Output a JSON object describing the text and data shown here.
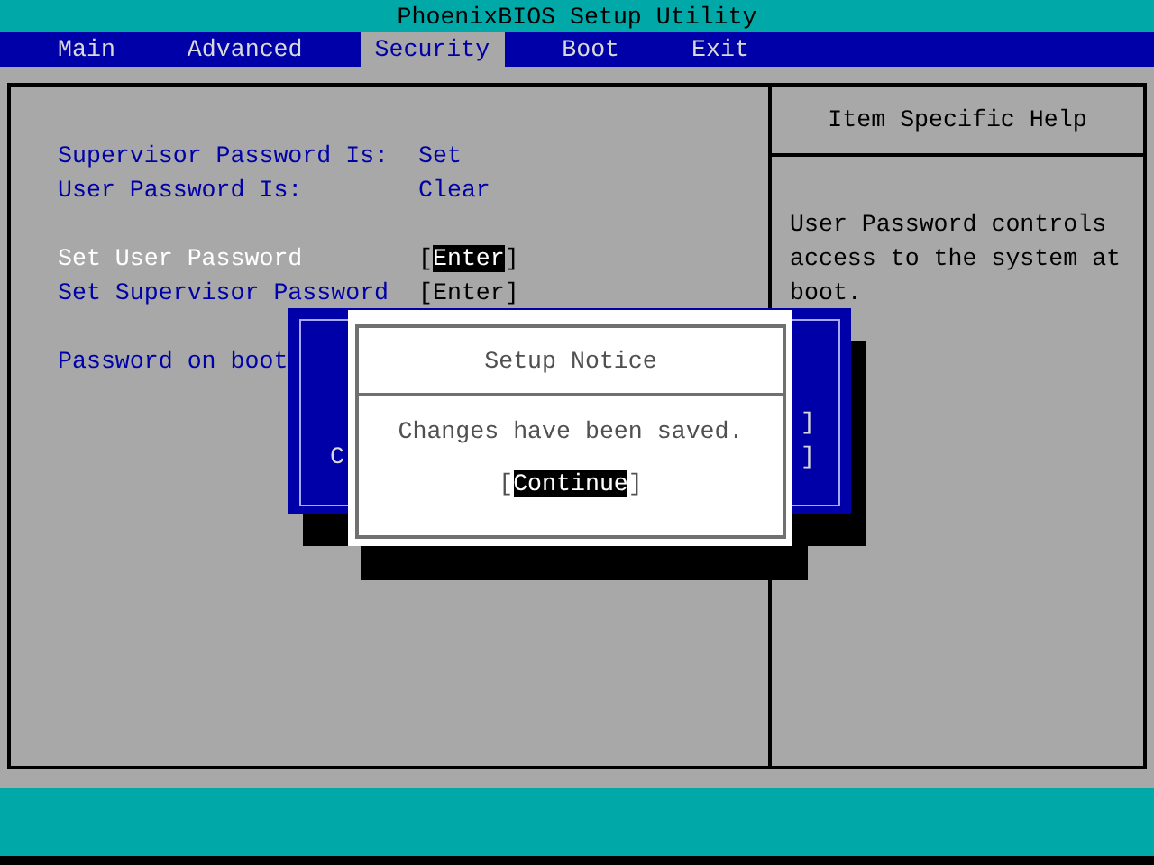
{
  "window": {
    "title": "PhoenixBIOS Setup Utility"
  },
  "tabs": [
    {
      "label": "Main",
      "selected": false
    },
    {
      "label": "Advanced",
      "selected": false
    },
    {
      "label": "Security",
      "selected": true
    },
    {
      "label": "Boot",
      "selected": false
    },
    {
      "label": "Exit",
      "selected": false
    }
  ],
  "status": [
    {
      "label": "Supervisor Password Is:",
      "value": "Set"
    },
    {
      "label": "User Password Is:",
      "value": "Clear"
    }
  ],
  "items": [
    {
      "label": "Set User Password",
      "open": "[",
      "value": "Enter",
      "close": "]",
      "selected": true
    },
    {
      "label": "Set Supervisor Password",
      "open": "[",
      "value": "Enter",
      "close": "]",
      "selected": false
    },
    {
      "label": "Password on boot",
      "selected": false
    }
  ],
  "help": {
    "title": "Item Specific Help",
    "text": "User Password controls access to the system at boot."
  },
  "background_dialog": {
    "fragments": [
      {
        "text": "C",
        "kind": "left"
      },
      {
        "text": "]",
        "kind": "right"
      },
      {
        "text": "]",
        "kind": "right"
      }
    ]
  },
  "dialog": {
    "title": "Setup Notice",
    "message": "Changes have been saved.",
    "button": {
      "open": "[",
      "label": "Continue",
      "close": "]",
      "selected": true
    }
  }
}
